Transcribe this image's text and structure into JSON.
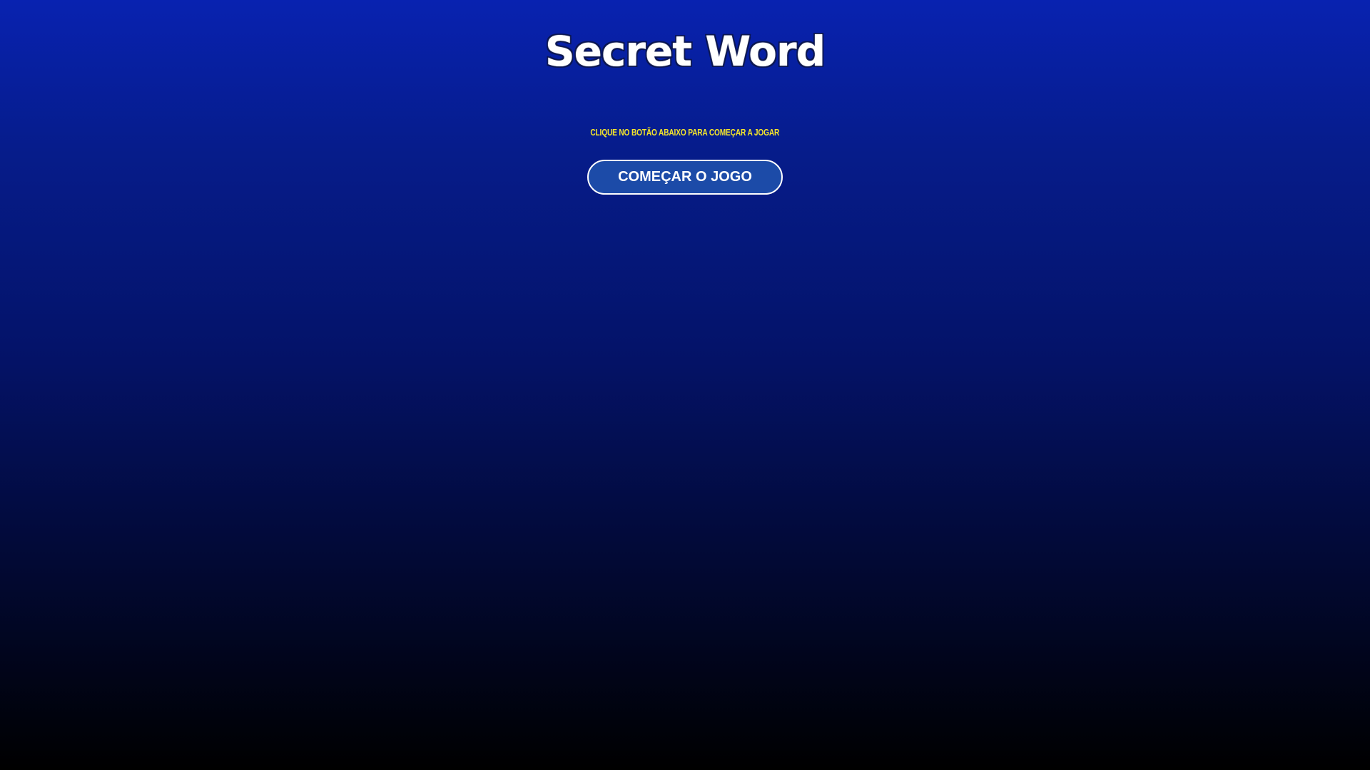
{
  "game": {
    "title": "Secret Word",
    "subtitle": "CLIQUE NO BOTÃO ABAIXO PARA COMEÇAR A JOGAR",
    "start_button_label": "COMEÇAR O JOGO"
  },
  "colors": {
    "background_top": "#0822b0",
    "background_bottom": "#000000",
    "subtitle": "#f5e62a",
    "button_fill": "#1c4ba8",
    "button_border": "#ffffff",
    "title_fill": "#ffffff"
  }
}
